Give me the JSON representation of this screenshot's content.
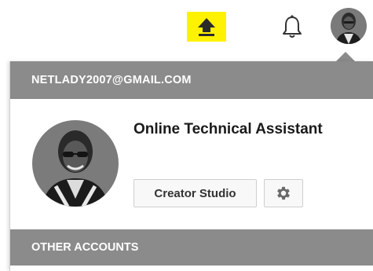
{
  "header": {
    "upload_icon": "upload-arrow-icon",
    "notifications_icon": "bell-icon",
    "avatar_icon": "user-avatar",
    "upload_highlight_color": "#fff200"
  },
  "account_menu": {
    "email": "NETLADY2007@GMAIL.COM",
    "account_name": "Online Technical Assistant",
    "creator_studio_label": "Creator Studio",
    "settings_icon": "gear-icon",
    "other_accounts_label": "OTHER ACCOUNTS",
    "header_bar_color": "#8b8b8b"
  }
}
